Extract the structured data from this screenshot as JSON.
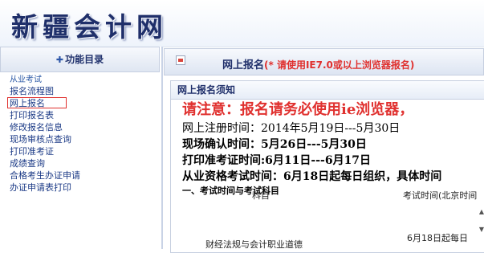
{
  "header": {
    "site_title": "新疆会计网"
  },
  "sidebar": {
    "title": "功能目录",
    "category": "从业考试",
    "items": [
      {
        "label": "报名流程图"
      },
      {
        "label": "网上报名"
      },
      {
        "label": "打印报名表"
      },
      {
        "label": "修改报名信息"
      },
      {
        "label": "现场审核点查询"
      },
      {
        "label": "打印准考证"
      },
      {
        "label": "成绩查询"
      },
      {
        "label": "合格考生办证申请"
      },
      {
        "label": "办证申请表打印"
      }
    ],
    "active_item": "网上报名"
  },
  "main": {
    "title": "网上报名",
    "title_warning": "(* 请使用IE7.0或以上浏览器报名)",
    "notice_title": "网上报名须知",
    "alert": "请注意：报名请务必使用ie浏览器，",
    "lines": [
      "网上注册时间：2014年5月19日---5月30日",
      "现场确认时间：5月26日---5月30日",
      "打印准考证时间:6月11日---6月17日",
      "从业资格考试时间：6月18日起每日组织，具体时间"
    ],
    "section_heading": "一、考试时间与考试科目",
    "table": {
      "headers": [
        "科目",
        "考试时间(北京时间"
      ],
      "rows": [
        [
          "财经法规与会计职业道德",
          "6月18日起每日"
        ]
      ]
    }
  },
  "colors": {
    "accent": "#1f2f6a",
    "link": "#1b3a86",
    "alert": "#e0312f"
  }
}
